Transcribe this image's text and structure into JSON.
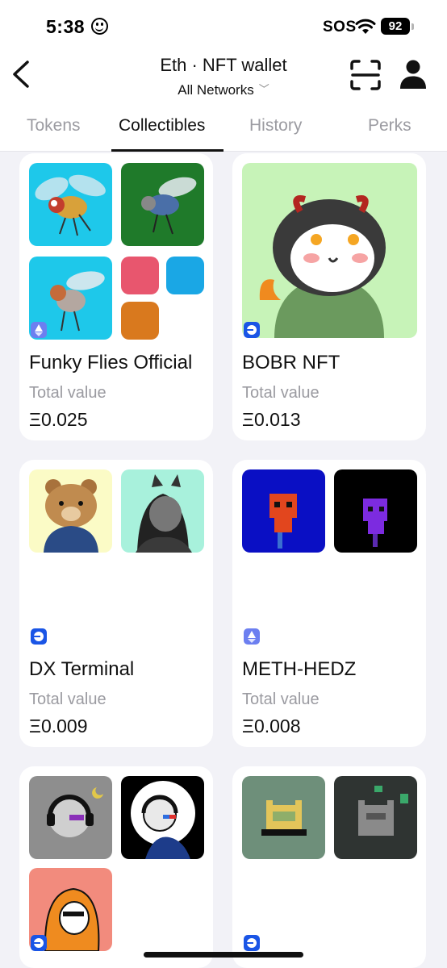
{
  "status_bar": {
    "time": "5:38",
    "sos": "SOS",
    "battery": "92"
  },
  "header": {
    "title": "Eth · NFT wallet",
    "network": "All Networks",
    "network_chevron": "﹀"
  },
  "tabs": [
    {
      "label": "Tokens"
    },
    {
      "label": "Collectibles"
    },
    {
      "label": "History"
    },
    {
      "label": "Perks"
    }
  ],
  "active_tab": "Collectibles",
  "collections": [
    {
      "name": "Funky Flies Official",
      "value_label": "Total value",
      "value": "Ξ0.025",
      "network": "ethereum-icon"
    },
    {
      "name": "BOBR NFT",
      "value_label": "Total value",
      "value": "Ξ0.013",
      "network": "base-icon"
    },
    {
      "name": "DX Terminal",
      "value_label": "Total value",
      "value": "Ξ0.009",
      "network": "base-icon"
    },
    {
      "name": "METH-HEDZ",
      "value_label": "Total value",
      "value": "Ξ0.008",
      "network": "ethereum-icon"
    },
    {
      "network": "base-icon"
    },
    {
      "network": "base-icon"
    }
  ],
  "colors": {
    "background": "#f2f2f7",
    "card": "#ffffff",
    "muted": "#9b9ba1",
    "eth_badge": "#6c7ff0",
    "base_badge": "#1a55e6"
  }
}
